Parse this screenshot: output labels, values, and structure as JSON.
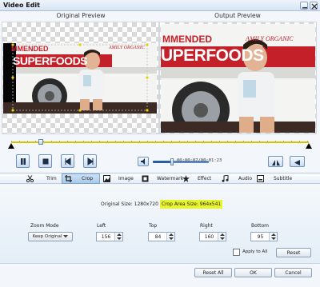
{
  "window": {
    "title": "Video Edit"
  },
  "preview": {
    "original_title": "Original Preview",
    "output_title": "Output Preview",
    "sign_line1": "MMENDED",
    "sign_line1_tail": "AMILY ORGANIC",
    "sign_line2": "SUPERFOODS",
    "sign_line2_output": "UPERFOODS"
  },
  "playback": {
    "timecode": "00:00:07/00:01:23",
    "volume_fraction": 0.32
  },
  "tabs": [
    {
      "label": "Trim",
      "icon": "scissors-icon"
    },
    {
      "label": "Crop",
      "icon": "crop-icon"
    },
    {
      "label": "Image",
      "icon": "image-icon"
    },
    {
      "label": "Watermark",
      "icon": "watermark-icon"
    },
    {
      "label": "Effect",
      "icon": "star-icon"
    },
    {
      "label": "Audio",
      "icon": "music-note-icon"
    },
    {
      "label": "Subtitle",
      "icon": "subtitle-icon"
    }
  ],
  "active_tab": "Crop",
  "crop": {
    "original_size": "Original Size: 1280x720",
    "crop_area_size": "Crop Area Size: 964x541",
    "zoom_mode_label": "Zoom Mode",
    "zoom_mode_value": "Keep Original",
    "left_label": "Left",
    "left_value": "156",
    "top_label": "Top",
    "top_value": "84",
    "right_label": "Right",
    "right_value": "160",
    "bottom_label": "Bottom",
    "bottom_value": "95",
    "apply_to_all": "Apply to All",
    "reset": "Reset"
  },
  "footer": {
    "reset_all": "Reset All",
    "ok": "OK",
    "cancel": "Cancel"
  },
  "colors": {
    "highlight": "#e9f52c",
    "timeline": "#d6c200",
    "accent": "#2b5ea0"
  }
}
